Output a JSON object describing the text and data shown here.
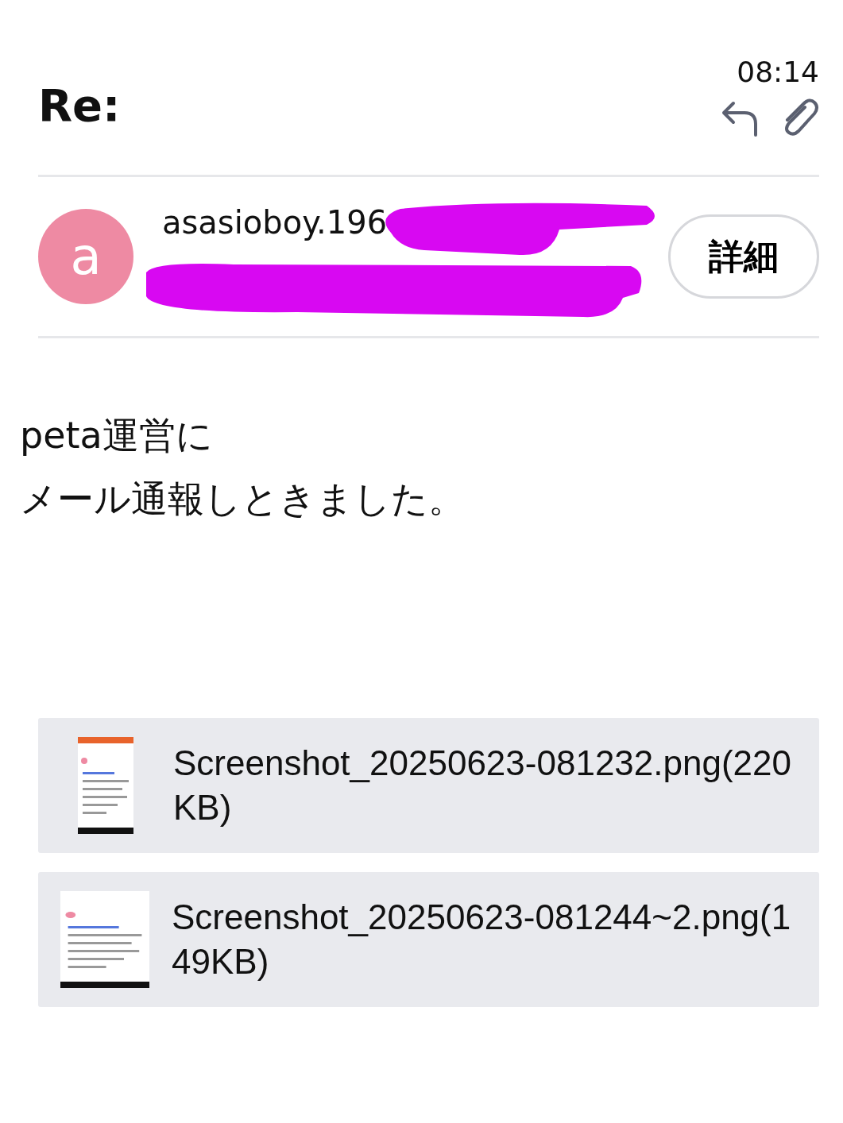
{
  "header": {
    "subject": "Re:",
    "time": "08:14"
  },
  "sender": {
    "name": "asasioboy.196",
    "avatar_letter": "a",
    "details_button": "詳細"
  },
  "body": [
    "peta運営に",
    "メール通報しときました。"
  ],
  "attachments": [
    {
      "filename": "Screenshot_20250623-081232.png(220KB)"
    },
    {
      "filename": "Screenshot_20250623-081244~2.png(149KB)"
    }
  ]
}
